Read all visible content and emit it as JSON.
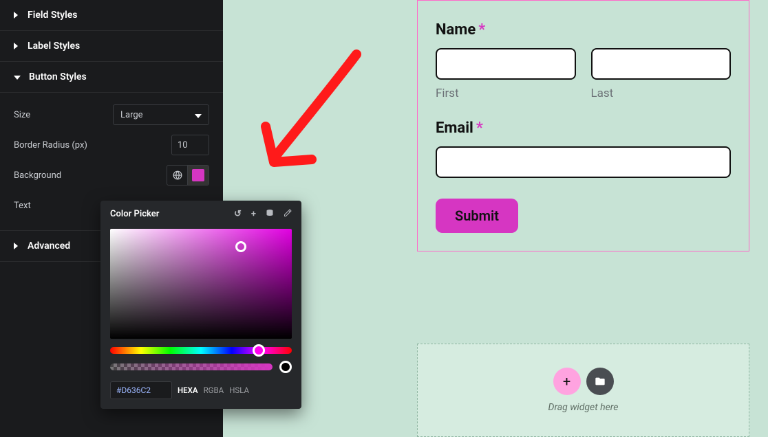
{
  "sidebar": {
    "sections": {
      "field_styles": "Field Styles",
      "label_styles": "Label Styles",
      "button_styles": "Button Styles",
      "advanced": "Advanced"
    },
    "button_styles": {
      "size_label": "Size",
      "size_value": "Large",
      "border_radius_label": "Border Radius (px)",
      "border_radius_value": "10",
      "background_label": "Background",
      "background_value": "#D636C2",
      "text_label": "Text"
    }
  },
  "color_picker": {
    "title": "Color Picker",
    "hex_value": "#D636C2",
    "formats": {
      "hexa": "HEXA",
      "rgba": "RGBA",
      "hsla": "HSLA"
    }
  },
  "form": {
    "name_label": "Name",
    "required_mark": "*",
    "first_label": "First",
    "last_label": "Last",
    "email_label": "Email",
    "submit_label": "Submit",
    "submit_bg": "#D636C2"
  },
  "dropzone": {
    "label": "Drag widget here"
  }
}
